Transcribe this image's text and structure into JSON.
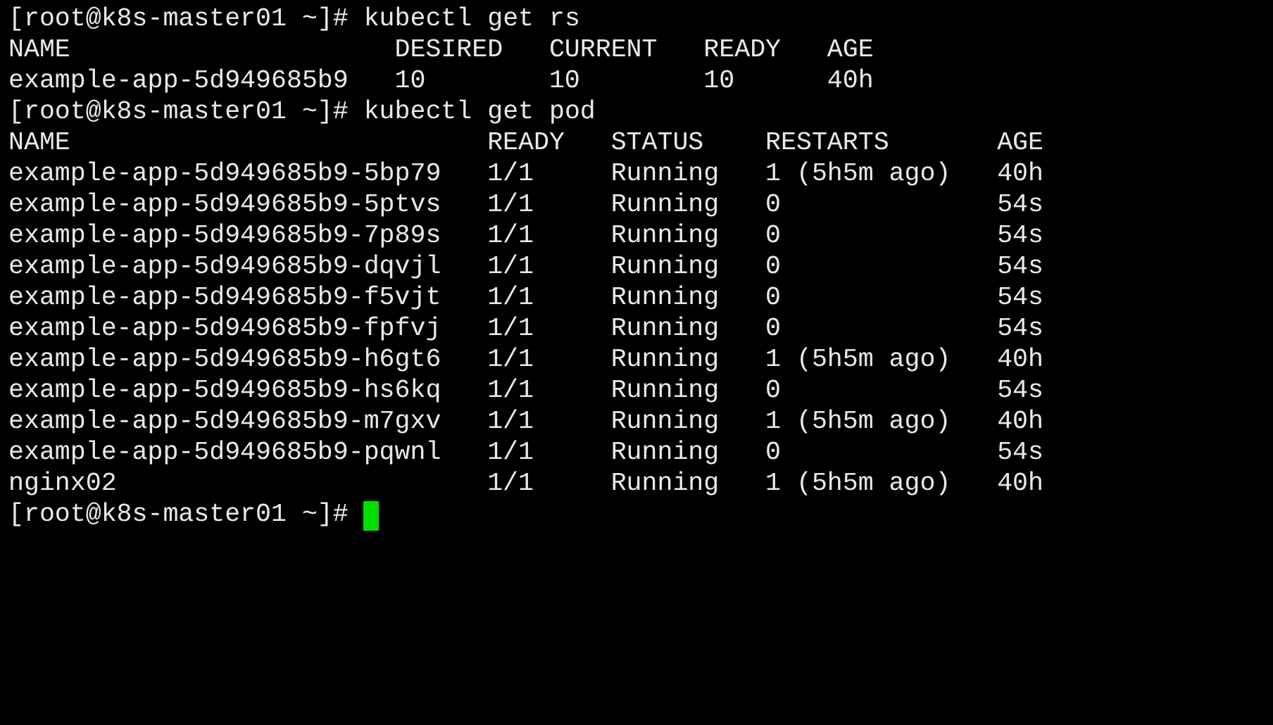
{
  "blocks": [
    {
      "prompt": "[root@k8s-master01 ~]#",
      "command": "kubectl get rs",
      "columns": [
        "NAME",
        "DESIRED",
        "CURRENT",
        "READY",
        "AGE"
      ],
      "rows": [
        [
          "example-app-5d949685b9",
          "10",
          "10",
          "10",
          "40h"
        ]
      ]
    },
    {
      "prompt": "[root@k8s-master01 ~]#",
      "command": "kubectl get pod",
      "columns": [
        "NAME",
        "READY",
        "STATUS",
        "RESTARTS",
        "AGE"
      ],
      "rows": [
        [
          "example-app-5d949685b9-5bp79",
          "1/1",
          "Running",
          "1 (5h5m ago)",
          "40h"
        ],
        [
          "example-app-5d949685b9-5ptvs",
          "1/1",
          "Running",
          "0",
          "54s"
        ],
        [
          "example-app-5d949685b9-7p89s",
          "1/1",
          "Running",
          "0",
          "54s"
        ],
        [
          "example-app-5d949685b9-dqvjl",
          "1/1",
          "Running",
          "0",
          "54s"
        ],
        [
          "example-app-5d949685b9-f5vjt",
          "1/1",
          "Running",
          "0",
          "54s"
        ],
        [
          "example-app-5d949685b9-fpfvj",
          "1/1",
          "Running",
          "0",
          "54s"
        ],
        [
          "example-app-5d949685b9-h6gt6",
          "1/1",
          "Running",
          "1 (5h5m ago)",
          "40h"
        ],
        [
          "example-app-5d949685b9-hs6kq",
          "1/1",
          "Running",
          "0",
          "54s"
        ],
        [
          "example-app-5d949685b9-m7gxv",
          "1/1",
          "Running",
          "1 (5h5m ago)",
          "40h"
        ],
        [
          "example-app-5d949685b9-pqwnl",
          "1/1",
          "Running",
          "0",
          "54s"
        ],
        [
          "nginx02",
          "1/1",
          "Running",
          "1 (5h5m ago)",
          "40h"
        ]
      ]
    }
  ],
  "final_prompt": "[root@k8s-master01 ~]#"
}
